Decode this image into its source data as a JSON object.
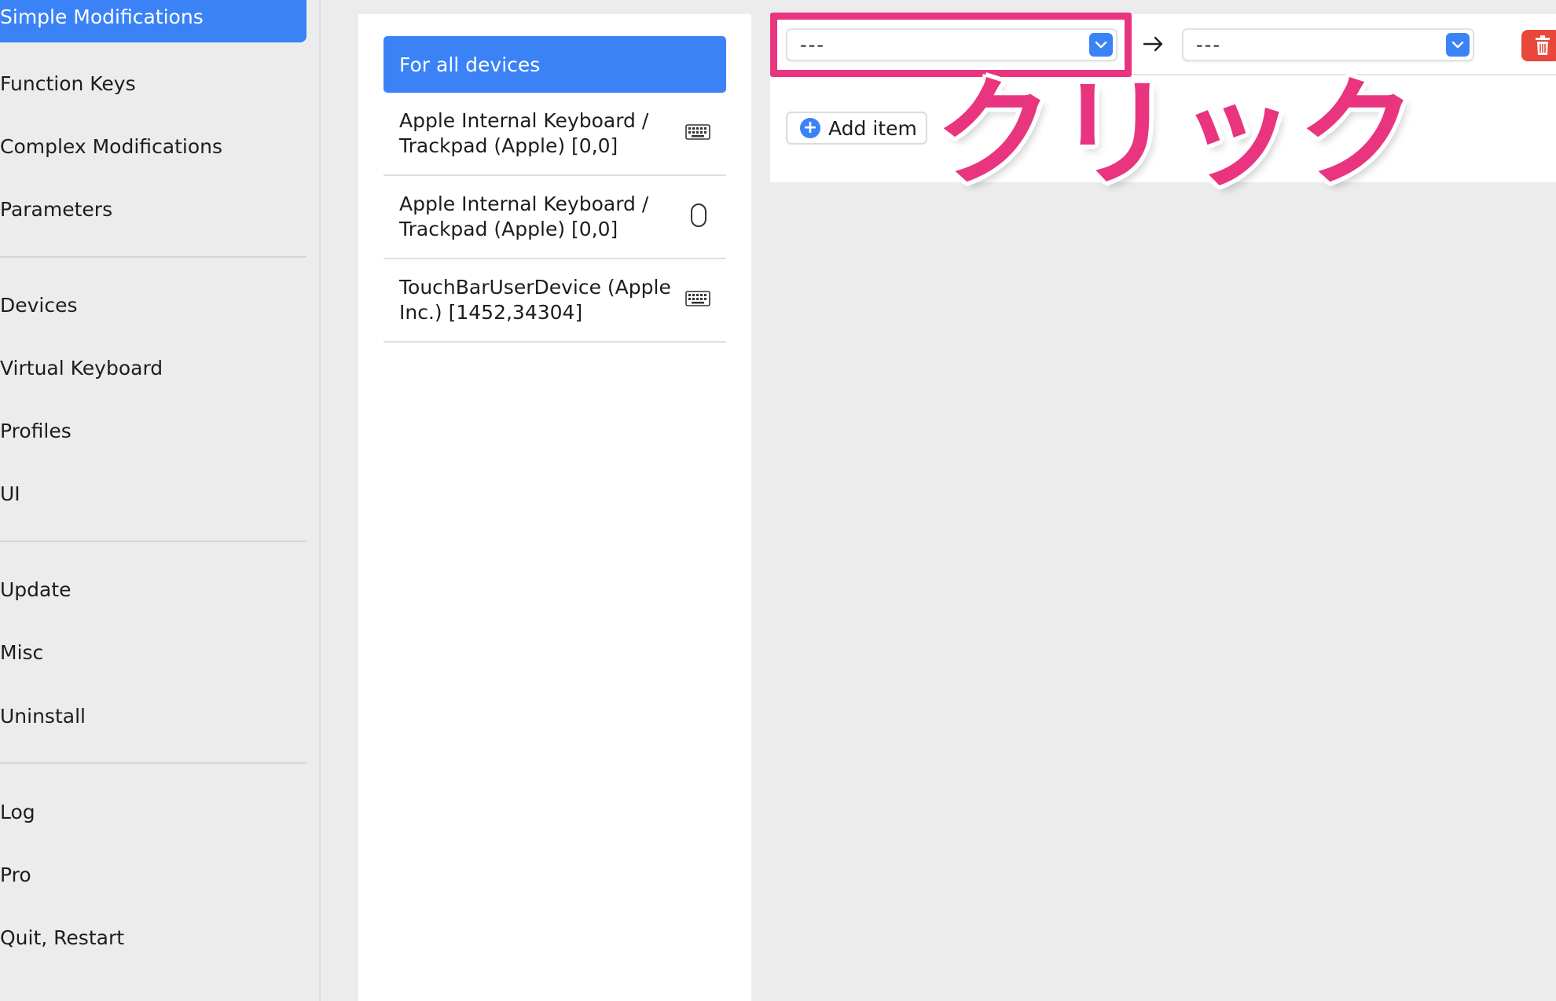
{
  "sidebar": {
    "items": [
      {
        "label": "Simple Modifications",
        "active": true
      },
      {
        "label": "Function Keys"
      },
      {
        "label": "Complex Modifications"
      },
      {
        "label": "Parameters"
      },
      {
        "label": "Devices"
      },
      {
        "label": "Virtual Keyboard"
      },
      {
        "label": "Profiles"
      },
      {
        "label": "UI"
      },
      {
        "label": "Update"
      },
      {
        "label": "Misc"
      },
      {
        "label": "Uninstall"
      },
      {
        "label": "Log"
      },
      {
        "label": "Pro"
      },
      {
        "label": "Quit, Restart"
      }
    ]
  },
  "devices": {
    "all_label": "For all devices",
    "rows": [
      {
        "label": "Apple Internal Keyboard / Trackpad (Apple) [0,0]",
        "icon": "keyboard-icon"
      },
      {
        "label": "Apple Internal Keyboard / Trackpad (Apple) [0,0]",
        "icon": "mouse-icon"
      },
      {
        "label": "TouchBarUserDevice (Apple Inc.) [1452,34304]",
        "icon": "keyboard-icon"
      }
    ]
  },
  "mapping": {
    "from_value": "---",
    "to_value": "---",
    "add_item_label": "Add item"
  },
  "annotation": {
    "text": "クリック",
    "color": "#e9347f"
  },
  "colors": {
    "accent": "#3a82f6",
    "delete": "#e8473a"
  }
}
